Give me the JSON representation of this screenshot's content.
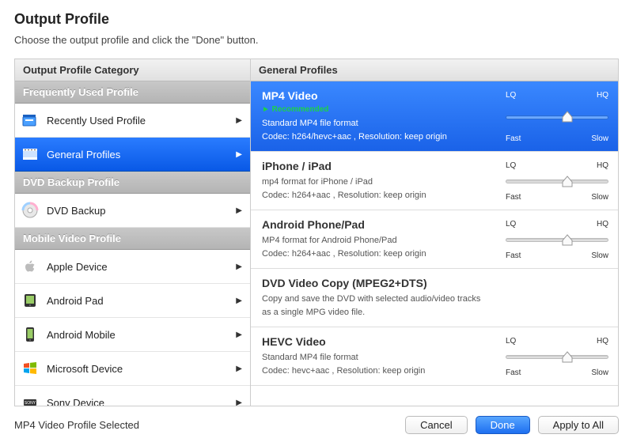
{
  "header": {
    "title": "Output Profile",
    "subtitle": "Choose the output profile and click the \"Done\" button."
  },
  "sidebar": {
    "header": "Output Profile Category",
    "sections": [
      {
        "title": "Frequently Used Profile",
        "items": [
          {
            "icon": "recent",
            "label": "Recently Used Profile",
            "selected": false
          },
          {
            "icon": "film",
            "label": "General Profiles",
            "selected": true
          }
        ]
      },
      {
        "title": "DVD Backup Profile",
        "items": [
          {
            "icon": "disc",
            "label": "DVD Backup",
            "selected": false
          }
        ]
      },
      {
        "title": "Mobile Video Profile",
        "items": [
          {
            "icon": "apple",
            "label": "Apple Device",
            "selected": false
          },
          {
            "icon": "android",
            "label": "Android Pad",
            "selected": false
          },
          {
            "icon": "android2",
            "label": "Android Mobile",
            "selected": false
          },
          {
            "icon": "windows",
            "label": "Microsoft Device",
            "selected": false
          },
          {
            "icon": "sony",
            "label": "Sony Device",
            "selected": false
          }
        ]
      }
    ]
  },
  "content": {
    "header": "General Profiles",
    "profiles": [
      {
        "title": "MP4 Video",
        "recommended": "► Recommended",
        "desc": "Standard MP4 file format",
        "codec": "Codec: h264/hevc+aac , Resolution: keep origin",
        "lq": "LQ",
        "hq": "HQ",
        "fast": "Fast",
        "slow": "Slow",
        "slider_pct": 60,
        "selected": true
      },
      {
        "title": "iPhone / iPad",
        "desc": "mp4 format for iPhone / iPad",
        "codec": "Codec: h264+aac , Resolution: keep origin",
        "lq": "LQ",
        "hq": "HQ",
        "fast": "Fast",
        "slow": "Slow",
        "slider_pct": 60,
        "selected": false
      },
      {
        "title": "Android Phone/Pad",
        "desc": "MP4 format for Android Phone/Pad",
        "codec": "Codec: h264+aac , Resolution: keep origin",
        "lq": "LQ",
        "hq": "HQ",
        "fast": "Fast",
        "slow": "Slow",
        "slider_pct": 60,
        "selected": false
      },
      {
        "title": "DVD Video Copy (MPEG2+DTS)",
        "desc": "Copy and save the DVD with selected audio/video tracks\n as a single MPG video file.",
        "codec": "",
        "slider_pct": null,
        "selected": false
      },
      {
        "title": "HEVC Video",
        "desc": "Standard MP4 file format",
        "codec": "Codec: hevc+aac , Resolution: keep origin",
        "lq": "LQ",
        "hq": "HQ",
        "fast": "Fast",
        "slow": "Slow",
        "slider_pct": 60,
        "selected": false
      }
    ]
  },
  "footer": {
    "status": "MP4 Video Profile Selected",
    "cancel": "Cancel",
    "done": "Done",
    "apply": "Apply to All"
  }
}
